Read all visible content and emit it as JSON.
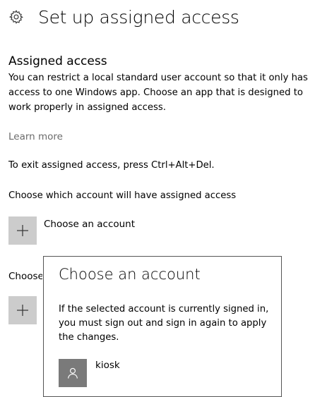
{
  "header": {
    "title": "Set up assigned access",
    "icon": "gear-icon"
  },
  "assigned_access": {
    "heading": "Assigned access",
    "description": "You can restrict a local standard user account so that it only has access to one Windows app. Choose an app that is designed to work properly in assigned access.",
    "learn_more": "Learn more",
    "exit_instructions": "To exit assigned access, press Ctrl+Alt+Del.",
    "choose_which_account": "Choose which account will have assigned access",
    "choose_account_button_label": "Choose an account",
    "choose_app_clipped_label": "Choose"
  },
  "flyout": {
    "title": "Choose an account",
    "message": "If the selected account is currently signed in, you must sign out and sign in again to apply the changes.",
    "accounts": [
      {
        "name": "kiosk",
        "icon": "user-icon"
      }
    ]
  },
  "colors": {
    "tile_background": "#cccccc",
    "avatar_background": "#7a7a7a",
    "link_gray": "#6b6b6b",
    "flyout_border": "#555555"
  }
}
